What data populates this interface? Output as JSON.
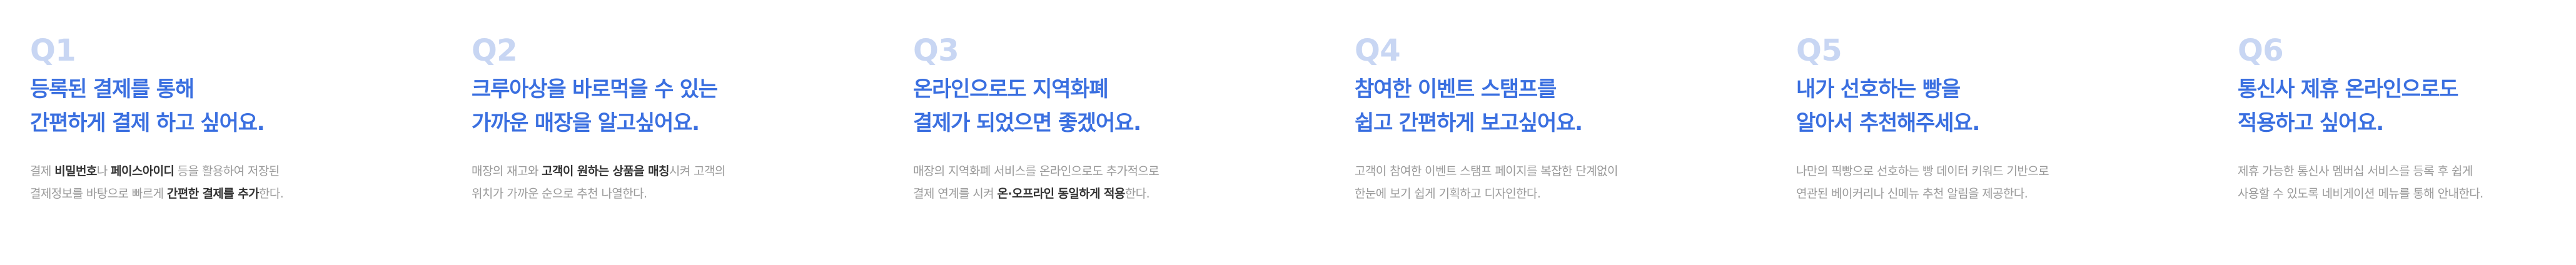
{
  "cards": [
    {
      "label": "Q1",
      "title_lines": [
        "등록된 결제를 통해",
        "간편하게 결제 하고 싶어요."
      ],
      "desc_lines": [
        [
          {
            "t": "결제 "
          },
          {
            "t": "비밀번호",
            "b": true
          },
          {
            "t": "나 "
          },
          {
            "t": "페이스아이디",
            "b": true
          },
          {
            "t": " 등을 활용하여 저장된"
          }
        ],
        [
          {
            "t": "결제정보를 바탕으로 빠르게 "
          },
          {
            "t": "간편한 결제를 추가",
            "b": true
          },
          {
            "t": "한다."
          }
        ]
      ]
    },
    {
      "label": "Q2",
      "title_lines": [
        "크루아상을 바로먹을 수 있는",
        "가까운 매장을 알고싶어요."
      ],
      "desc_lines": [
        [
          {
            "t": "매장의 재고와 "
          },
          {
            "t": "고객이 원하는 상품을 매칭",
            "b": true
          },
          {
            "t": "시켜 고객의"
          }
        ],
        [
          {
            "t": "위치가 가까운 순으로 추천 나열한다."
          }
        ]
      ]
    },
    {
      "label": "Q3",
      "title_lines": [
        "온라인으로도 지역화폐",
        "결제가 되었으면 좋겠어요."
      ],
      "desc_lines": [
        [
          {
            "t": "매장의 지역화폐 서비스를 온라인으로도 추가적으로"
          }
        ],
        [
          {
            "t": "결제 연계를 시켜 "
          },
          {
            "t": "온·오프라인 동일하게 적용",
            "b": true
          },
          {
            "t": "한다."
          }
        ]
      ]
    },
    {
      "label": "Q4",
      "title_lines": [
        "참여한 이벤트 스탬프를",
        "쉽고 간편하게 보고싶어요."
      ],
      "desc_lines": [
        [
          {
            "t": "고객이 참여한 이벤트 스탬프 페이지를 복잡한 단계없이"
          }
        ],
        [
          {
            "t": "한눈에 보기 쉽게 기획하고 디자인한다."
          }
        ]
      ]
    },
    {
      "label": "Q5",
      "title_lines": [
        "내가 선호하는 빵을",
        "알아서 추천해주세요."
      ],
      "desc_lines": [
        [
          {
            "t": "나만의 픽빵으로 선호하는 빵 데이터 키워드 기반으로"
          }
        ],
        [
          {
            "t": "연관된 베이커리나 신메뉴 추천 알림을 제공한다."
          }
        ]
      ]
    },
    {
      "label": "Q6",
      "title_lines": [
        "통신사 제휴 온라인으로도",
        "적용하고 싶어요."
      ],
      "desc_lines": [
        [
          {
            "t": "제휴 가능한 통신사 멤버십 서비스를 등록 후 쉽게"
          }
        ],
        [
          {
            "t": "사용할 수 있도록 네비게이션 메뉴를 통해 안내한다."
          }
        ]
      ]
    }
  ]
}
